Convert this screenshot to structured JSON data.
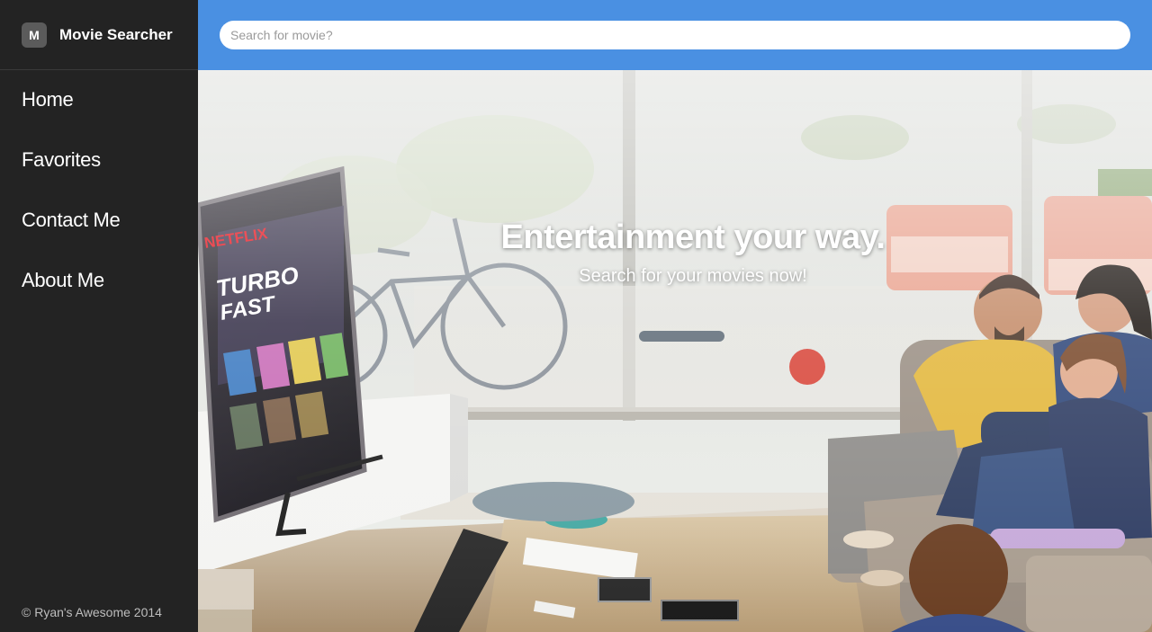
{
  "brand": {
    "badge": "M",
    "name": "Movie Searcher"
  },
  "nav": {
    "items": [
      {
        "label": "Home"
      },
      {
        "label": "Favorites"
      },
      {
        "label": "Contact Me"
      },
      {
        "label": "About Me"
      }
    ]
  },
  "footer": {
    "text": "© Ryan's Awesome 2014"
  },
  "search": {
    "placeholder": "Search for movie?",
    "value": ""
  },
  "hero": {
    "title": "Entertainment your way.",
    "subtitle": "Search for your movies now!",
    "tv_brand": "NETFLIX",
    "tv_show": "TURBO FAST"
  },
  "colors": {
    "sidebar": "#232323",
    "header": "#4a90e2",
    "text": "#ffffff"
  }
}
